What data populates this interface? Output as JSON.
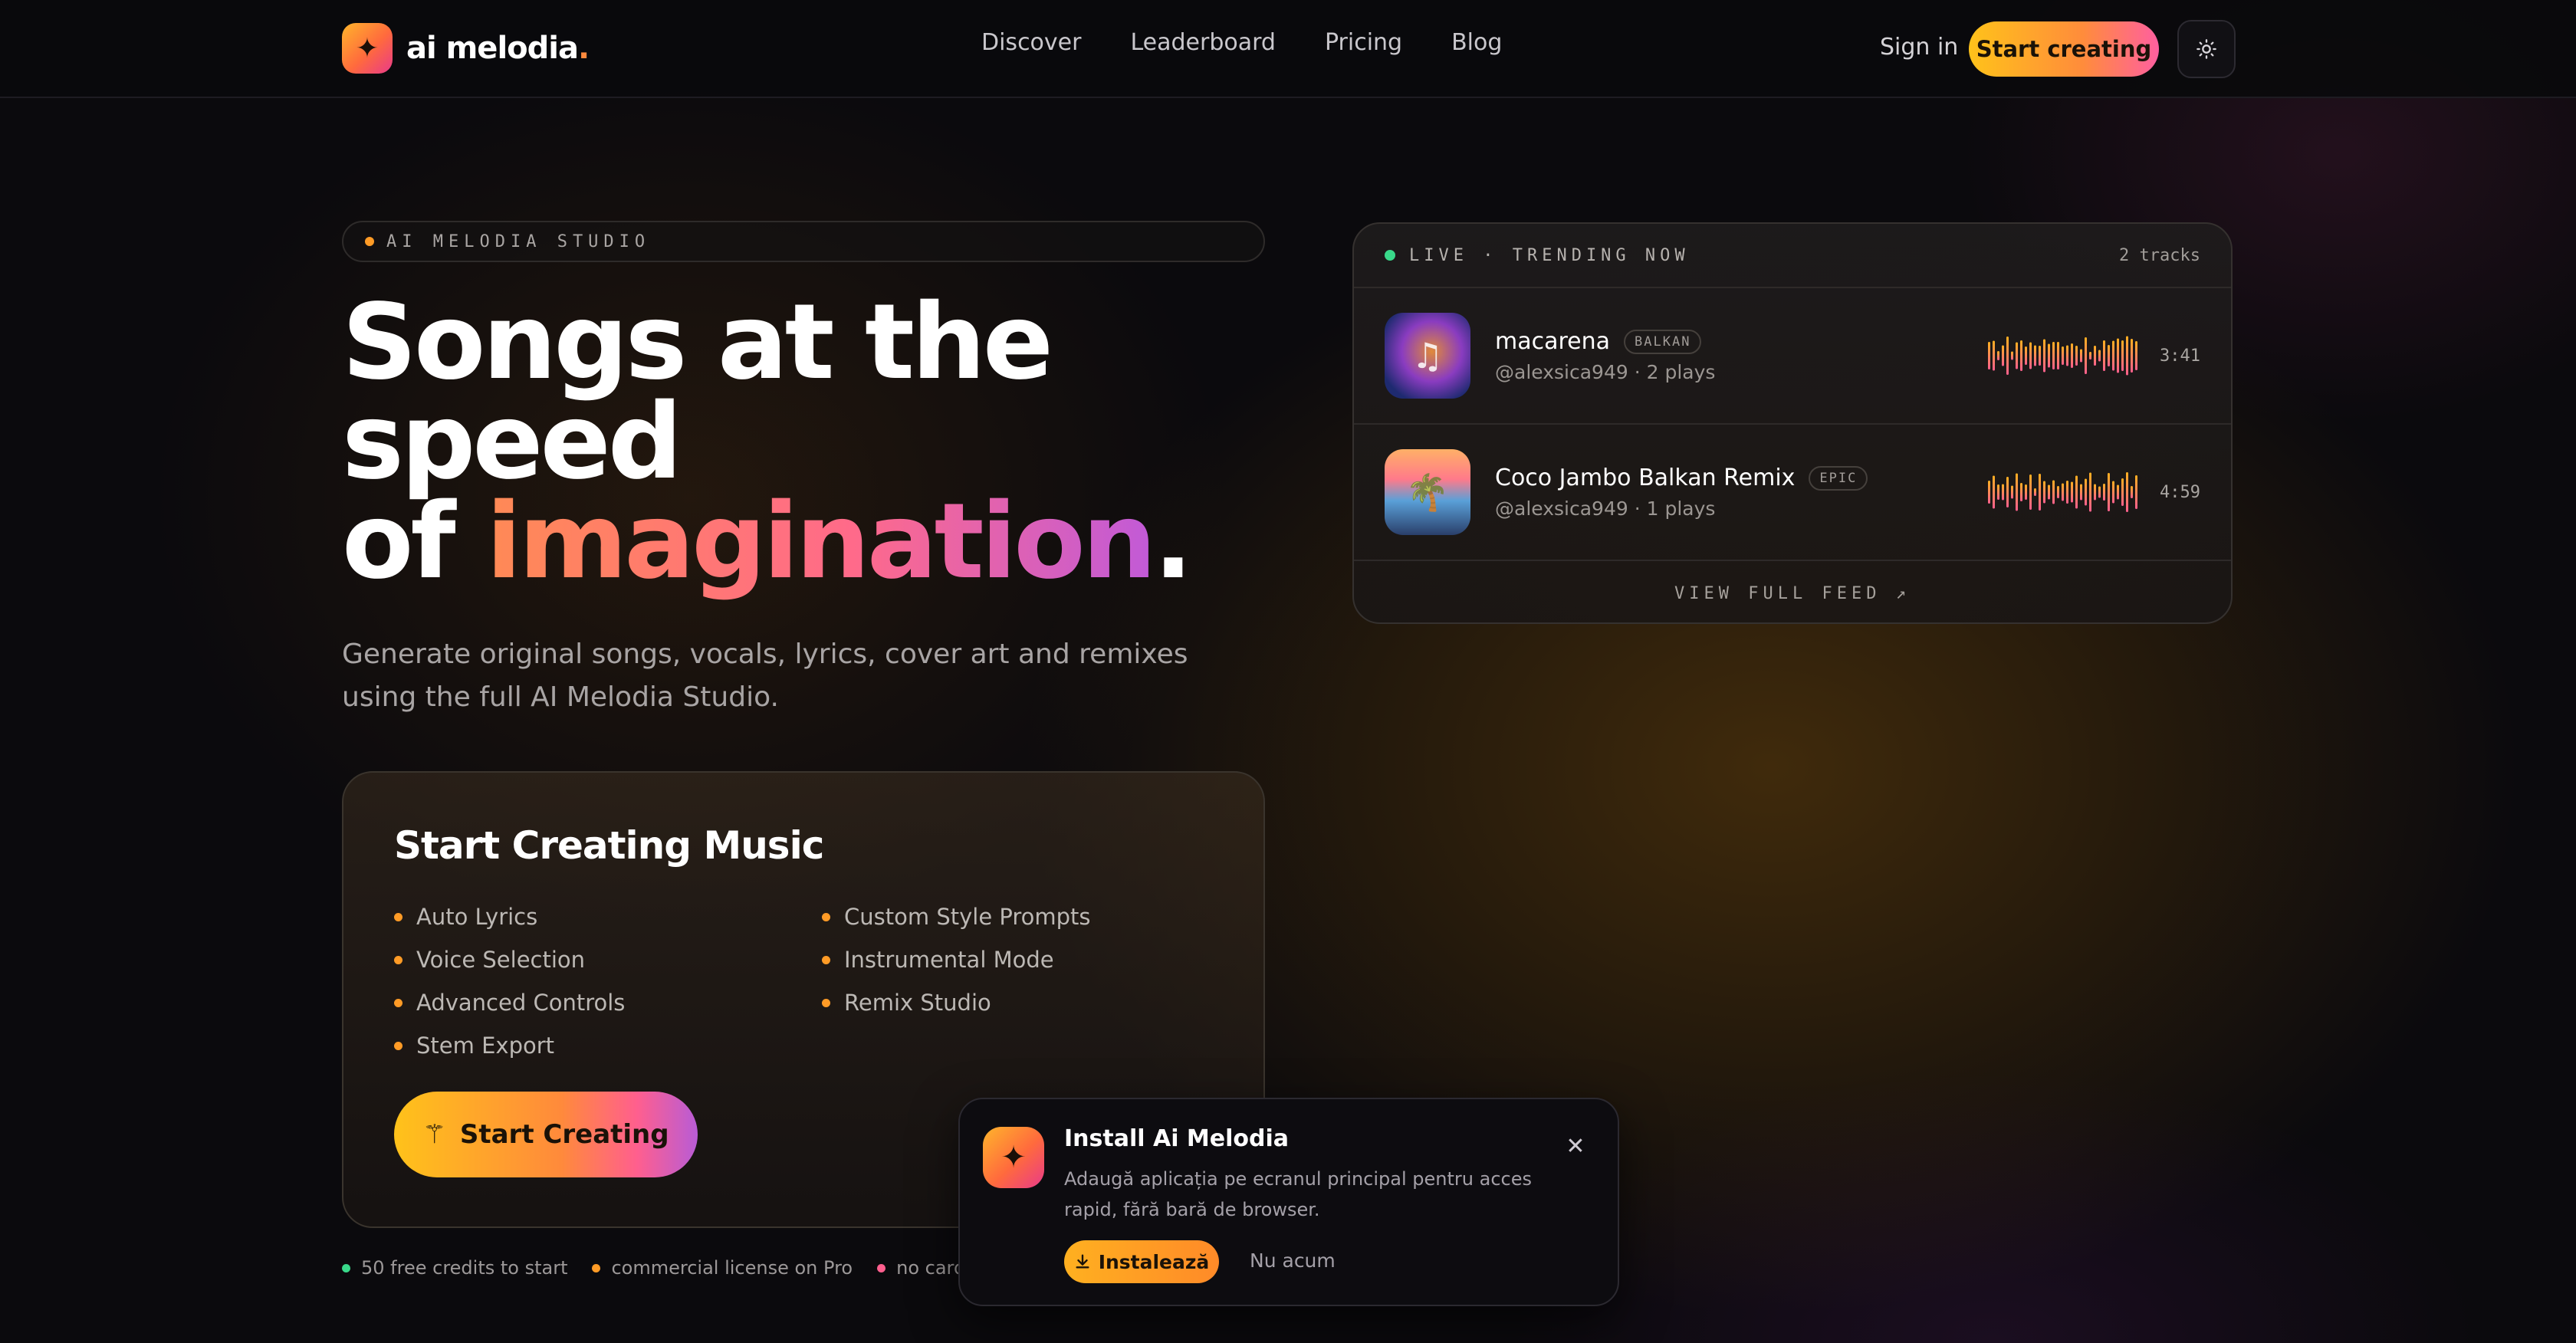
{
  "nav": {
    "logo_text": "ai melodia",
    "logo_dot": ".",
    "links": [
      "Discover",
      "Leaderboard",
      "Pricing",
      "Blog"
    ],
    "sign_in": "Sign in",
    "start_creating": "Start creating",
    "theme_icon": "sun-icon"
  },
  "hero": {
    "badge": "AI MELODIA STUDIO",
    "headline_line1": "Songs at the",
    "headline_line2": "speed",
    "headline_line3_prefix": "of ",
    "headline_line3_highlight": "imagination",
    "headline_line3_suffix": ".",
    "subtitle": "Generate original songs, vocals, lyrics, cover art and remixes using the full AI Melodia Studio."
  },
  "create_card": {
    "title": "Start Creating Music",
    "features_left": [
      "Auto Lyrics",
      "Voice Selection",
      "Advanced Controls",
      "Stem Export"
    ],
    "features_right": [
      "Custom Style Prompts",
      "Instrumental Mode",
      "Remix Studio"
    ],
    "cta": "Start Creating",
    "bullet_color": "#ff9b26"
  },
  "perks": [
    {
      "label": "50 free credits to start",
      "color": "#39d98a"
    },
    {
      "label": "commercial license on Pro",
      "color": "#ff9b26"
    },
    {
      "label": "no card re",
      "color": "#ff5f8e"
    }
  ],
  "trending": {
    "header": "LIVE · TRENDING NOW",
    "count": "2 tracks",
    "tracks": [
      {
        "title": "macarena",
        "tag": "BALKAN",
        "meta": "@alexsica949 · 2 plays",
        "duration": "3:41"
      },
      {
        "title": "Coco Jambo Balkan Remix",
        "tag": "EPIC",
        "meta": "@alexsica949 · 1 plays",
        "duration": "4:59"
      }
    ],
    "view_feed": "VIEW FULL FEED ↗"
  },
  "install_toast": {
    "title": "Install Ai Melodia",
    "text": "Adaugă aplicația pe ecranul principal pentru acces rapid, fără bară de browser.",
    "install": "Instalează",
    "not_now": "Nu acum"
  },
  "colors": {
    "accent_orange": "#ff9b26",
    "accent_pink": "#ff5f8e",
    "accent_purple": "#b85cd6",
    "live_green": "#39d98a",
    "background": "#0b0a0d"
  }
}
